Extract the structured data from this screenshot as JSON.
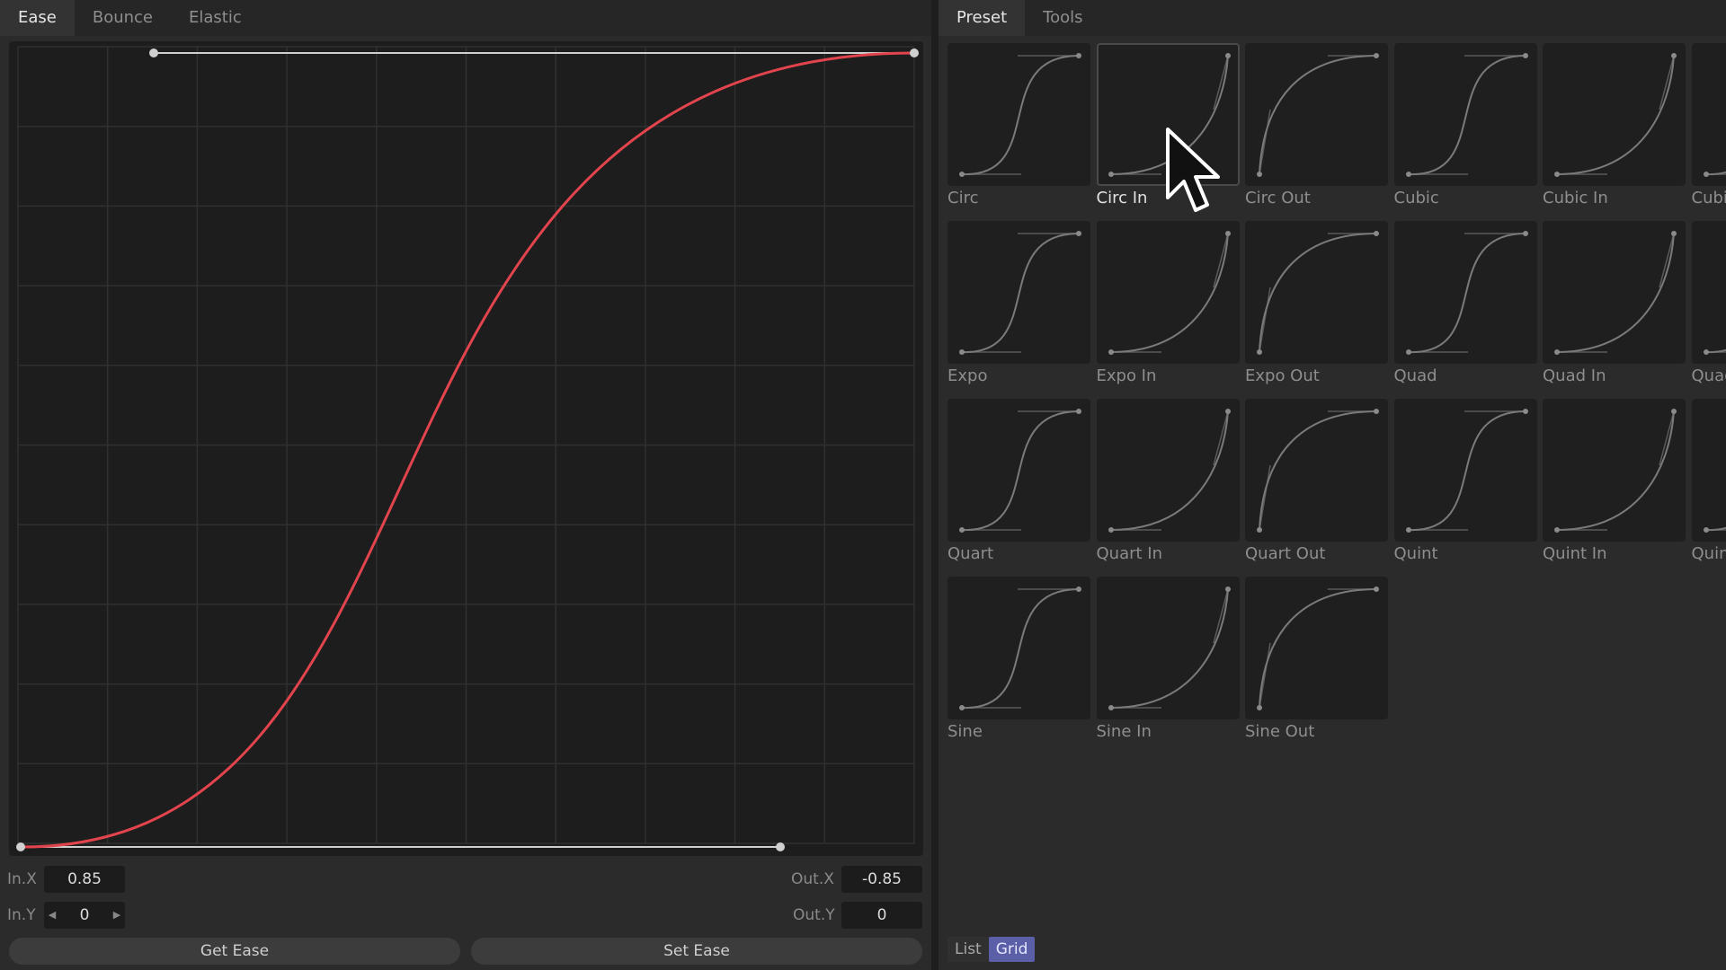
{
  "left_tabs": [
    "Ease",
    "Bounce",
    "Elastic"
  ],
  "right_tabs": [
    "Preset",
    "Tools"
  ],
  "curve": {
    "color": "#e2444d",
    "type": "sigmoid-ease-in-out"
  },
  "fields": {
    "in_x_label": "In.X",
    "in_x_value": "0.85",
    "in_y_label": "In.Y",
    "in_y_value": "0",
    "out_x_label": "Out.X",
    "out_x_value": "-0.85",
    "out_y_label": "Out.Y",
    "out_y_value": "0"
  },
  "buttons": {
    "get_ease": "Get Ease",
    "set_ease": "Set Ease"
  },
  "presets": [
    {
      "label": "Circ",
      "shape": "inout"
    },
    {
      "label": "Circ In",
      "shape": "in"
    },
    {
      "label": "Circ Out",
      "shape": "out"
    },
    {
      "label": "Cubic",
      "shape": "inout"
    },
    {
      "label": "Cubic In",
      "shape": "in"
    },
    {
      "label": "Cubic",
      "shape": "inout"
    },
    {
      "label": "Expo",
      "shape": "inout"
    },
    {
      "label": "Expo In",
      "shape": "in"
    },
    {
      "label": "Expo Out",
      "shape": "out"
    },
    {
      "label": "Quad",
      "shape": "inout"
    },
    {
      "label": "Quad In",
      "shape": "in"
    },
    {
      "label": "Quad",
      "shape": "inout"
    },
    {
      "label": "Quart",
      "shape": "inout"
    },
    {
      "label": "Quart In",
      "shape": "in"
    },
    {
      "label": "Quart Out",
      "shape": "out"
    },
    {
      "label": "Quint",
      "shape": "inout"
    },
    {
      "label": "Quint In",
      "shape": "in"
    },
    {
      "label": "Quint",
      "shape": "inout"
    },
    {
      "label": "Sine",
      "shape": "inout"
    },
    {
      "label": "Sine In",
      "shape": "in"
    },
    {
      "label": "Sine Out",
      "shape": "out"
    }
  ],
  "hovered_preset": "Circ In",
  "view_modes": {
    "list": "List",
    "grid": "Grid",
    "active": "Grid"
  }
}
